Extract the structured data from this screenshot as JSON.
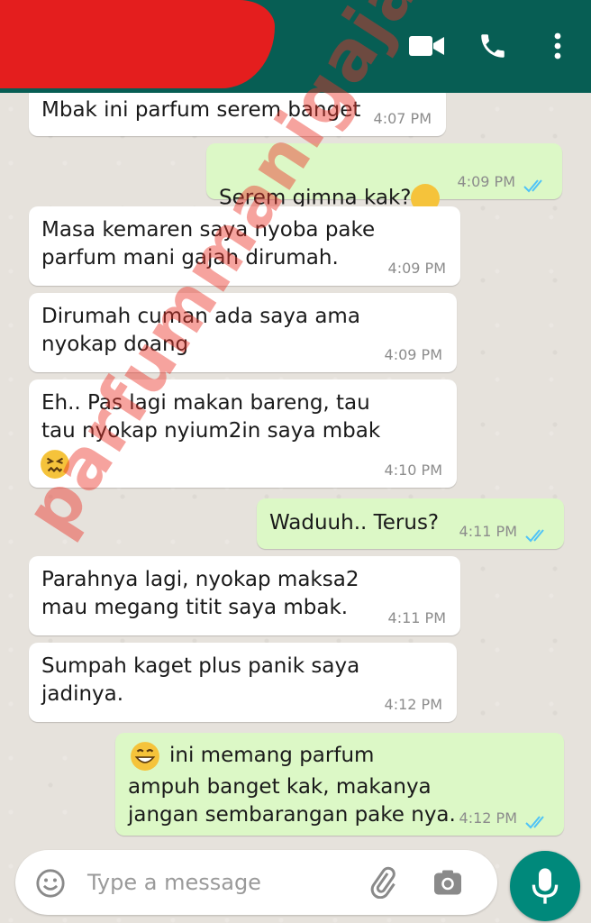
{
  "header": {
    "video_icon": "video-call-icon",
    "call_icon": "phone-icon",
    "menu_icon": "more-vert-icon"
  },
  "messages": [
    {
      "dir": "in",
      "text": "Mbak ini parfum serem banget",
      "time": "4:07 PM"
    },
    {
      "dir": "out",
      "text": "Serem gimna kak?",
      "emoji": "thinking-face",
      "time": "4:09 PM",
      "status": "read"
    },
    {
      "dir": "in",
      "text": "Masa kemaren saya nyoba pake\nparfum mani gajah dirumah.",
      "time": "4:09 PM"
    },
    {
      "dir": "in",
      "text": "Dirumah cuman ada saya ama\nnyokap doang",
      "time": "4:09 PM"
    },
    {
      "dir": "in",
      "text": "Eh.. Pas lagi makan bareng, tau\ntau nyokap nyium2in saya mbak",
      "emoji": "confounded-face",
      "time": "4:10 PM"
    },
    {
      "dir": "out",
      "text": "Waduuh.. Terus?",
      "time": "4:11 PM",
      "status": "read"
    },
    {
      "dir": "in",
      "text": "Parahnya lagi, nyokap maksa2\nmau megang titit saya mbak.",
      "time": "4:11 PM"
    },
    {
      "dir": "in",
      "text": "Sumpah kaget plus panik saya\njadinya.",
      "time": "4:12 PM"
    },
    {
      "dir": "out",
      "line1": "ini memang parfum",
      "line2": "ampuh banget kak, makanya\njangan sembarangan pake nya.",
      "emoji": "grinning-face",
      "time": "4:12 PM",
      "status": "read"
    }
  ],
  "input": {
    "placeholder": "Type a message",
    "emoji_icon": "emoji-icon",
    "attach_icon": "paperclip-icon",
    "camera_icon": "camera-icon",
    "mic_icon": "microphone-icon"
  },
  "watermark": "parfummanigajah.com",
  "colors": {
    "header": "#075e54",
    "incoming": "#ffffff",
    "outgoing": "#dcf8c6",
    "read_ticks": "#4fc3f7",
    "mic_button": "#00897b"
  }
}
